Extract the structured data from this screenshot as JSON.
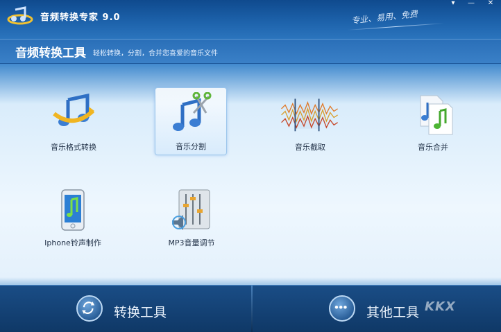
{
  "window": {
    "title": "音频转换专家 9.0",
    "slogan": "专业、易用、免费",
    "controls": {
      "minimize": "▾",
      "restore": "—",
      "close": "✕"
    }
  },
  "header": {
    "title": "音频转换工具",
    "subtitle": "轻松转换，分割，合并您喜爱的音乐文件"
  },
  "tools": [
    {
      "label": "音乐格式转换",
      "icon": "music-convert-icon",
      "selected": false
    },
    {
      "label": "音乐分割",
      "icon": "music-split-icon",
      "selected": true
    },
    {
      "label": "音乐截取",
      "icon": "music-cut-icon",
      "selected": false
    },
    {
      "label": "音乐合并",
      "icon": "music-merge-icon",
      "selected": false
    },
    {
      "label": "Iphone铃声制作",
      "icon": "iphone-ringtone-icon",
      "selected": false
    },
    {
      "label": "MP3音量调节",
      "icon": "mp3-volume-icon",
      "selected": false
    }
  ],
  "bottom_tabs": [
    {
      "label": "转换工具",
      "icon": "refresh-icon"
    },
    {
      "label": "其他工具",
      "icon": "more-dots-icon"
    }
  ],
  "watermark": "KKX"
}
